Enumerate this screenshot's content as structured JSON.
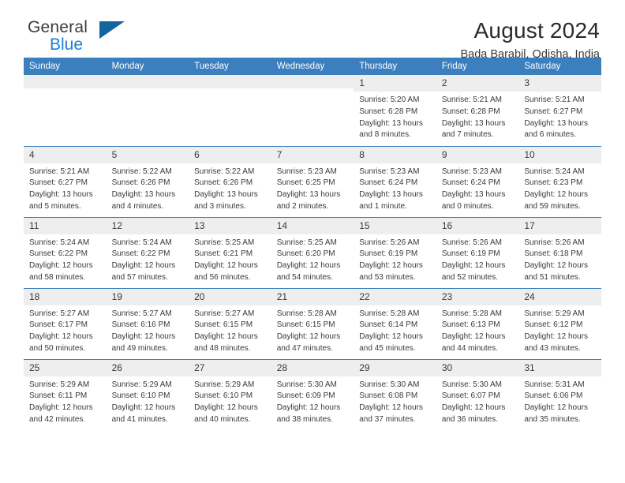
{
  "brand": {
    "line1": "General",
    "line2": "Blue",
    "triangle_icon": "blue-triangle-logo-mark",
    "color_text": "#3c3c3c",
    "color_blue": "#1c7fd6",
    "color_triangle": "#12659f"
  },
  "header": {
    "title": "August 2024",
    "subtitle": "Bada Barabil, Odisha, India"
  },
  "theme": {
    "header_bg": "#3c7fbf",
    "header_text": "#ffffff",
    "daynum_bg": "#eeeeee",
    "body_text": "#3a3a3a",
    "row_divider": "#3c7fbf"
  },
  "weekday_headers": [
    "Sunday",
    "Monday",
    "Tuesday",
    "Wednesday",
    "Thursday",
    "Friday",
    "Saturday"
  ],
  "labels": {
    "sunrise": "Sunrise:",
    "sunset": "Sunset:",
    "daylight": "Daylight:"
  },
  "weeks": [
    [
      {
        "day": "",
        "empty": true,
        "sunrise": "",
        "sunset": "",
        "daylight1": "",
        "daylight2": ""
      },
      {
        "day": "",
        "empty": true,
        "sunrise": "",
        "sunset": "",
        "daylight1": "",
        "daylight2": ""
      },
      {
        "day": "",
        "empty": true,
        "sunrise": "",
        "sunset": "",
        "daylight1": "",
        "daylight2": ""
      },
      {
        "day": "",
        "empty": true,
        "sunrise": "",
        "sunset": "",
        "daylight1": "",
        "daylight2": ""
      },
      {
        "day": "1",
        "empty": false,
        "sunrise": "Sunrise: 5:20 AM",
        "sunset": "Sunset: 6:28 PM",
        "daylight1": "Daylight: 13 hours",
        "daylight2": "and 8 minutes."
      },
      {
        "day": "2",
        "empty": false,
        "sunrise": "Sunrise: 5:21 AM",
        "sunset": "Sunset: 6:28 PM",
        "daylight1": "Daylight: 13 hours",
        "daylight2": "and 7 minutes."
      },
      {
        "day": "3",
        "empty": false,
        "sunrise": "Sunrise: 5:21 AM",
        "sunset": "Sunset: 6:27 PM",
        "daylight1": "Daylight: 13 hours",
        "daylight2": "and 6 minutes."
      }
    ],
    [
      {
        "day": "4",
        "empty": false,
        "sunrise": "Sunrise: 5:21 AM",
        "sunset": "Sunset: 6:27 PM",
        "daylight1": "Daylight: 13 hours",
        "daylight2": "and 5 minutes."
      },
      {
        "day": "5",
        "empty": false,
        "sunrise": "Sunrise: 5:22 AM",
        "sunset": "Sunset: 6:26 PM",
        "daylight1": "Daylight: 13 hours",
        "daylight2": "and 4 minutes."
      },
      {
        "day": "6",
        "empty": false,
        "sunrise": "Sunrise: 5:22 AM",
        "sunset": "Sunset: 6:26 PM",
        "daylight1": "Daylight: 13 hours",
        "daylight2": "and 3 minutes."
      },
      {
        "day": "7",
        "empty": false,
        "sunrise": "Sunrise: 5:23 AM",
        "sunset": "Sunset: 6:25 PM",
        "daylight1": "Daylight: 13 hours",
        "daylight2": "and 2 minutes."
      },
      {
        "day": "8",
        "empty": false,
        "sunrise": "Sunrise: 5:23 AM",
        "sunset": "Sunset: 6:24 PM",
        "daylight1": "Daylight: 13 hours",
        "daylight2": "and 1 minute."
      },
      {
        "day": "9",
        "empty": false,
        "sunrise": "Sunrise: 5:23 AM",
        "sunset": "Sunset: 6:24 PM",
        "daylight1": "Daylight: 13 hours",
        "daylight2": "and 0 minutes."
      },
      {
        "day": "10",
        "empty": false,
        "sunrise": "Sunrise: 5:24 AM",
        "sunset": "Sunset: 6:23 PM",
        "daylight1": "Daylight: 12 hours",
        "daylight2": "and 59 minutes."
      }
    ],
    [
      {
        "day": "11",
        "empty": false,
        "sunrise": "Sunrise: 5:24 AM",
        "sunset": "Sunset: 6:22 PM",
        "daylight1": "Daylight: 12 hours",
        "daylight2": "and 58 minutes."
      },
      {
        "day": "12",
        "empty": false,
        "sunrise": "Sunrise: 5:24 AM",
        "sunset": "Sunset: 6:22 PM",
        "daylight1": "Daylight: 12 hours",
        "daylight2": "and 57 minutes."
      },
      {
        "day": "13",
        "empty": false,
        "sunrise": "Sunrise: 5:25 AM",
        "sunset": "Sunset: 6:21 PM",
        "daylight1": "Daylight: 12 hours",
        "daylight2": "and 56 minutes."
      },
      {
        "day": "14",
        "empty": false,
        "sunrise": "Sunrise: 5:25 AM",
        "sunset": "Sunset: 6:20 PM",
        "daylight1": "Daylight: 12 hours",
        "daylight2": "and 54 minutes."
      },
      {
        "day": "15",
        "empty": false,
        "sunrise": "Sunrise: 5:26 AM",
        "sunset": "Sunset: 6:19 PM",
        "daylight1": "Daylight: 12 hours",
        "daylight2": "and 53 minutes."
      },
      {
        "day": "16",
        "empty": false,
        "sunrise": "Sunrise: 5:26 AM",
        "sunset": "Sunset: 6:19 PM",
        "daylight1": "Daylight: 12 hours",
        "daylight2": "and 52 minutes."
      },
      {
        "day": "17",
        "empty": false,
        "sunrise": "Sunrise: 5:26 AM",
        "sunset": "Sunset: 6:18 PM",
        "daylight1": "Daylight: 12 hours",
        "daylight2": "and 51 minutes."
      }
    ],
    [
      {
        "day": "18",
        "empty": false,
        "sunrise": "Sunrise: 5:27 AM",
        "sunset": "Sunset: 6:17 PM",
        "daylight1": "Daylight: 12 hours",
        "daylight2": "and 50 minutes."
      },
      {
        "day": "19",
        "empty": false,
        "sunrise": "Sunrise: 5:27 AM",
        "sunset": "Sunset: 6:16 PM",
        "daylight1": "Daylight: 12 hours",
        "daylight2": "and 49 minutes."
      },
      {
        "day": "20",
        "empty": false,
        "sunrise": "Sunrise: 5:27 AM",
        "sunset": "Sunset: 6:15 PM",
        "daylight1": "Daylight: 12 hours",
        "daylight2": "and 48 minutes."
      },
      {
        "day": "21",
        "empty": false,
        "sunrise": "Sunrise: 5:28 AM",
        "sunset": "Sunset: 6:15 PM",
        "daylight1": "Daylight: 12 hours",
        "daylight2": "and 47 minutes."
      },
      {
        "day": "22",
        "empty": false,
        "sunrise": "Sunrise: 5:28 AM",
        "sunset": "Sunset: 6:14 PM",
        "daylight1": "Daylight: 12 hours",
        "daylight2": "and 45 minutes."
      },
      {
        "day": "23",
        "empty": false,
        "sunrise": "Sunrise: 5:28 AM",
        "sunset": "Sunset: 6:13 PM",
        "daylight1": "Daylight: 12 hours",
        "daylight2": "and 44 minutes."
      },
      {
        "day": "24",
        "empty": false,
        "sunrise": "Sunrise: 5:29 AM",
        "sunset": "Sunset: 6:12 PM",
        "daylight1": "Daylight: 12 hours",
        "daylight2": "and 43 minutes."
      }
    ],
    [
      {
        "day": "25",
        "empty": false,
        "sunrise": "Sunrise: 5:29 AM",
        "sunset": "Sunset: 6:11 PM",
        "daylight1": "Daylight: 12 hours",
        "daylight2": "and 42 minutes."
      },
      {
        "day": "26",
        "empty": false,
        "sunrise": "Sunrise: 5:29 AM",
        "sunset": "Sunset: 6:10 PM",
        "daylight1": "Daylight: 12 hours",
        "daylight2": "and 41 minutes."
      },
      {
        "day": "27",
        "empty": false,
        "sunrise": "Sunrise: 5:29 AM",
        "sunset": "Sunset: 6:10 PM",
        "daylight1": "Daylight: 12 hours",
        "daylight2": "and 40 minutes."
      },
      {
        "day": "28",
        "empty": false,
        "sunrise": "Sunrise: 5:30 AM",
        "sunset": "Sunset: 6:09 PM",
        "daylight1": "Daylight: 12 hours",
        "daylight2": "and 38 minutes."
      },
      {
        "day": "29",
        "empty": false,
        "sunrise": "Sunrise: 5:30 AM",
        "sunset": "Sunset: 6:08 PM",
        "daylight1": "Daylight: 12 hours",
        "daylight2": "and 37 minutes."
      },
      {
        "day": "30",
        "empty": false,
        "sunrise": "Sunrise: 5:30 AM",
        "sunset": "Sunset: 6:07 PM",
        "daylight1": "Daylight: 12 hours",
        "daylight2": "and 36 minutes."
      },
      {
        "day": "31",
        "empty": false,
        "sunrise": "Sunrise: 5:31 AM",
        "sunset": "Sunset: 6:06 PM",
        "daylight1": "Daylight: 12 hours",
        "daylight2": "and 35 minutes."
      }
    ]
  ]
}
